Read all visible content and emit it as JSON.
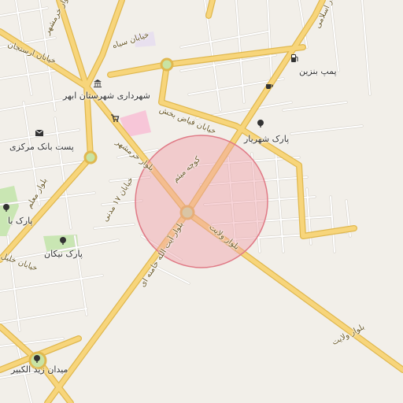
{
  "map": {
    "colors": {
      "background": "#f2efe9",
      "major_road": "#f7d57b",
      "major_road_casing": "#e0b84f",
      "minor_road": "#ffffff",
      "minor_road_casing": "#d6d2cb",
      "park": "#c9e6b3",
      "hospital": "#f7c6d8",
      "highlight_fill": "#f0a0a8",
      "highlight_stroke": "#e07a86",
      "roundabout": "#c9e3a3"
    },
    "labels": {
      "blvd_khorramshahr_top": "بلوار خرمشهر",
      "khiaban_siah": "خیابان سیاه",
      "khiaban_arsanjan": "خیابان ارسنجان",
      "shahrdari": "شهرداری شهرستان ابهر",
      "pomp_benzin": "پمپ بنزین",
      "blvd_eslami": "بلوار اسلامی",
      "faiz_bakhsh": "خیابان فیاض بخش",
      "park_shahriar": "پارک شهریار",
      "post_bank": "پست بانک مرکزی",
      "blvd_khorramshahr_mid": "بلوار خرمشهر",
      "koocheh_mitham": "کوچه میثم",
      "blvd_maalem": "بلوار معلم",
      "khiaban_modarres": "خیابان ۱۷ مدنی",
      "park_ba": "پارک با",
      "blvd_velayat_short": "بلوار ولایت",
      "blvd_ayatollah": "بلوار آیت الله خامنه ای",
      "park_nikan": "پارک نیکان",
      "khiaban_khalil": "خیابان خلیل",
      "blvd_velayat_long": "بلوار ولایت",
      "meydan_zeid": "میدان زید الکبیر"
    },
    "icons": [
      "bank-icon",
      "fuel-icon",
      "cafe-icon",
      "shopping-cart-icon",
      "post-icon",
      "tree-icon"
    ]
  }
}
